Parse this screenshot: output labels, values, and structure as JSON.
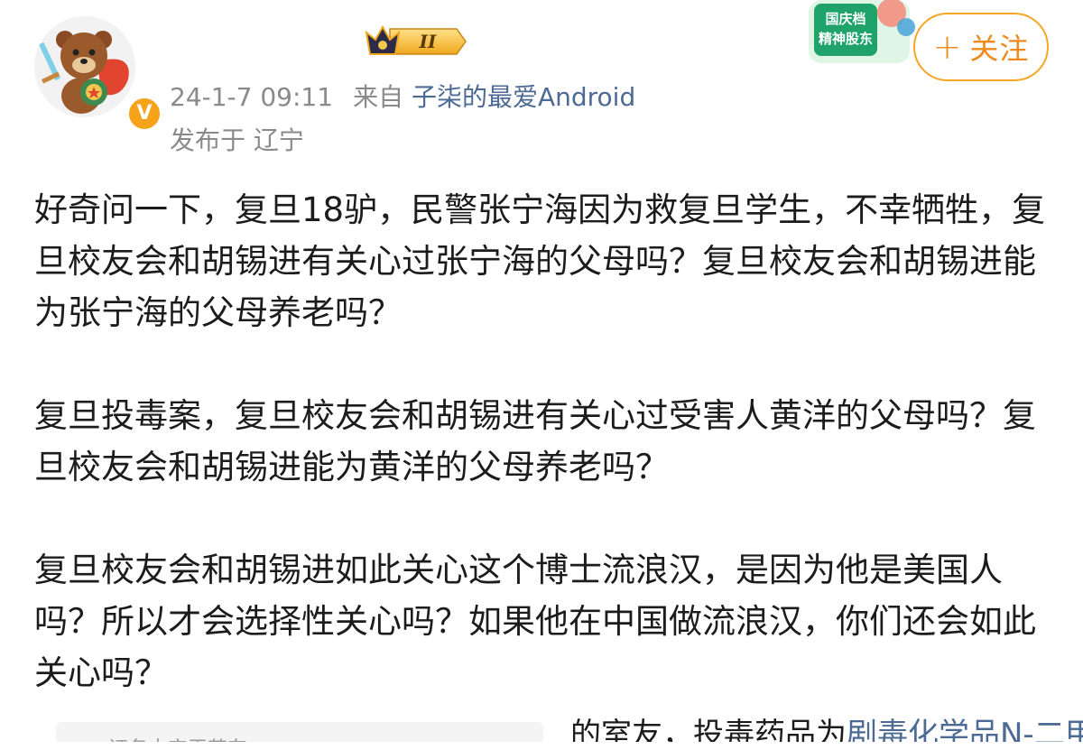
{
  "post": {
    "timestamp": "24-1-7 09:11",
    "source_prefix": "来自",
    "source_app": "子柒的最爱Android",
    "location": "发布于 辽宁",
    "vip_level": "II",
    "follow_label": "关注",
    "follow_plus": "+"
  },
  "promo": {
    "line1": "国庆档",
    "line2": "精神股东"
  },
  "content": {
    "paragraphs": [
      "好奇问一下，复旦18驴，民警张宁海因为救复旦学生，不幸牺牲，复旦校友会和胡锡进有关心过张宁海的父母吗？复旦校友会和胡锡进能为张宁海的父母养老吗？",
      "复旦投毒案，复旦校友会和胡锡进有关心过受害人黄洋的父母吗？复旦校友会和胡锡进能为黄洋的父母养老吗？",
      "复旦校友会和胡锡进如此关心这个博士流浪汉，是因为他是美国人吗？所以才会选择性关心吗？如果他在中国做流浪汉，你们还会如此关心吗？"
    ]
  },
  "quoted": {
    "left_text": "证务中宝王若东",
    "right_text": "的室友，投毒药品为",
    "right_link": "剧毒化学品N-二甲"
  },
  "colors": {
    "accent": "#f5a623",
    "link": "#4c6a94",
    "meta": "#8a8a8a"
  },
  "icons": {
    "avatar": "bear-hero-avatar",
    "verified": "verified-v-icon",
    "vip": "crown-vip-icon"
  }
}
